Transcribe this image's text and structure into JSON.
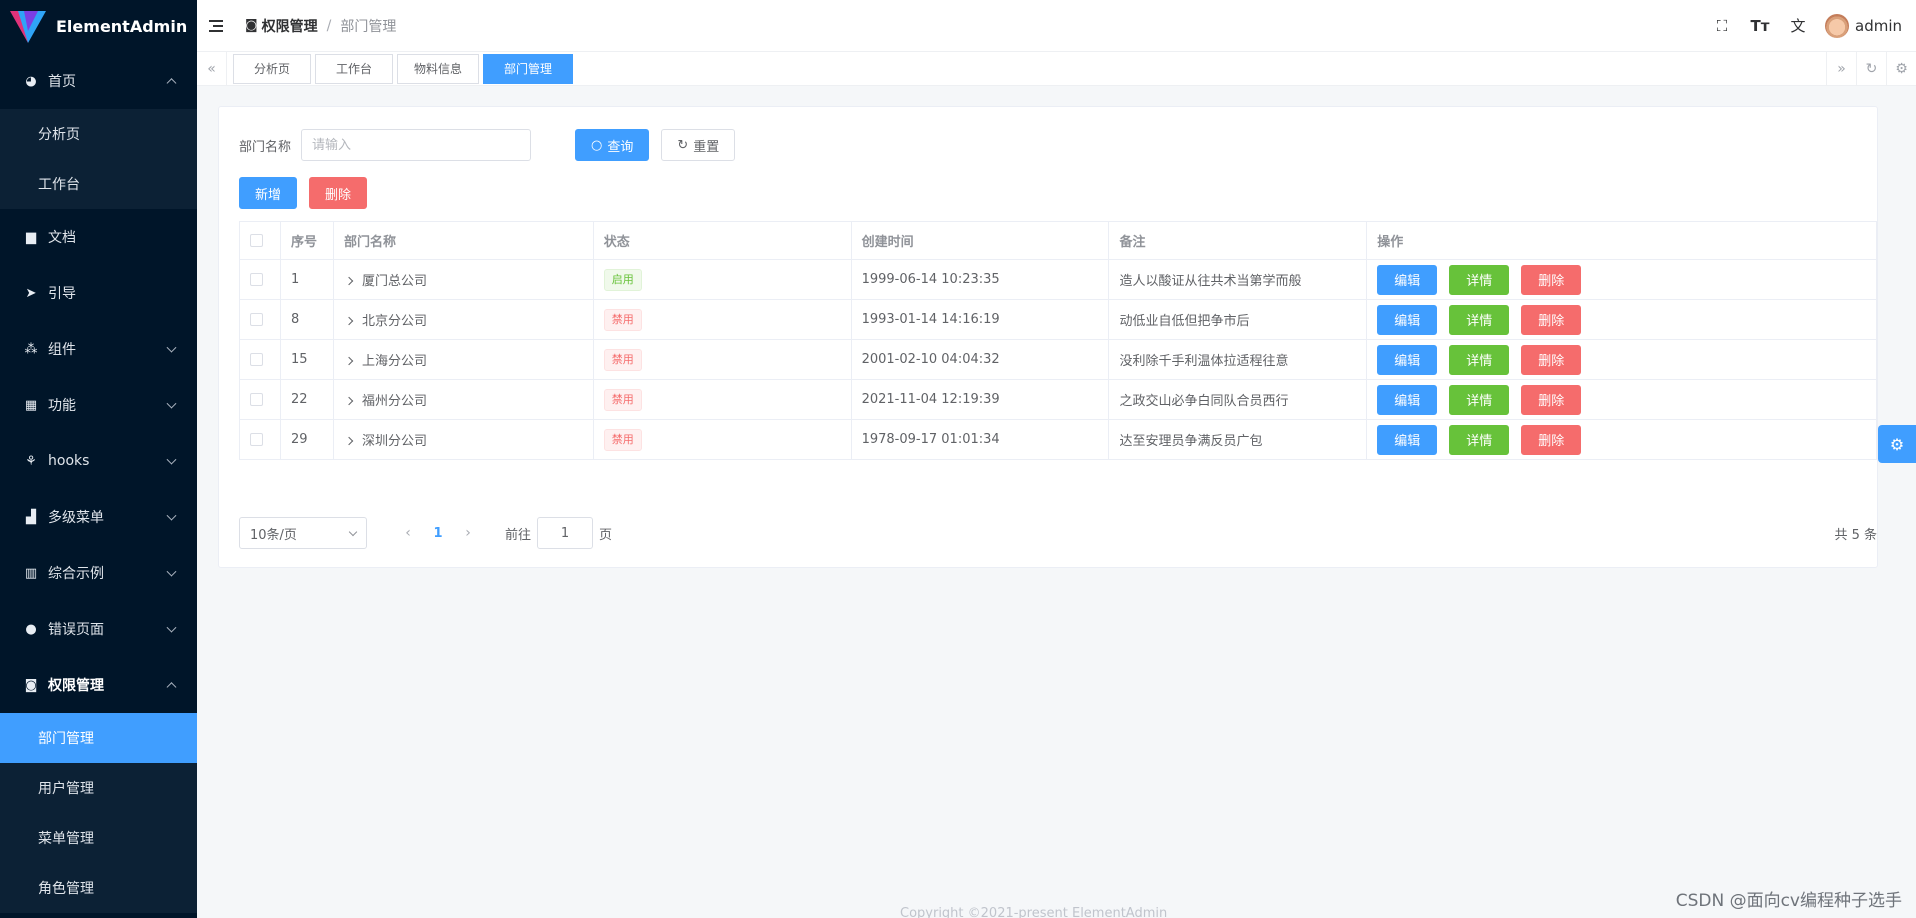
{
  "app": {
    "name": "ElementAdmin"
  },
  "sidebar": {
    "home": {
      "label": "首页",
      "children": [
        "分析页",
        "工作台"
      ]
    },
    "items": [
      {
        "label": "文档",
        "icon": "document-icon"
      },
      {
        "label": "引导",
        "icon": "send-icon"
      },
      {
        "label": "组件",
        "icon": "components-icon"
      },
      {
        "label": "功能",
        "icon": "grid-icon"
      },
      {
        "label": "hooks",
        "icon": "hooks-icon"
      },
      {
        "label": "多级菜单",
        "icon": "bar-chart-icon"
      },
      {
        "label": "综合示例",
        "icon": "library-icon"
      },
      {
        "label": "错误页面",
        "icon": "error-icon"
      }
    ],
    "permission": {
      "label": "权限管理",
      "children": [
        "部门管理",
        "用户管理",
        "菜单管理",
        "角色管理"
      ]
    }
  },
  "header": {
    "breadcrumb": [
      "权限管理",
      "部门管理"
    ],
    "user": "admin"
  },
  "tags": [
    "分析页",
    "工作台",
    "物料信息",
    "部门管理"
  ],
  "search": {
    "label": "部门名称",
    "placeholder": "请输入",
    "query": "查询",
    "reset": "重置"
  },
  "actions": {
    "add": "新增",
    "delete": "删除"
  },
  "table": {
    "columns": [
      "序号",
      "部门名称",
      "状态",
      "创建时间",
      "备注",
      "操作"
    ],
    "rows": [
      {
        "id": "1",
        "name": "厦门总公司",
        "status": "启用",
        "status_type": "on",
        "created": "1999-06-14 10:23:35",
        "remark": "造人以酸证从往共术当第学而般"
      },
      {
        "id": "8",
        "name": "北京分公司",
        "status": "禁用",
        "status_type": "off",
        "created": "1993-01-14 14:16:19",
        "remark": "动低业自低但把争市后"
      },
      {
        "id": "15",
        "name": "上海分公司",
        "status": "禁用",
        "status_type": "off",
        "created": "2001-02-10 04:04:32",
        "remark": "没利除千手利温体拉适程往意"
      },
      {
        "id": "22",
        "name": "福州分公司",
        "status": "禁用",
        "status_type": "off",
        "created": "2021-11-04 12:19:39",
        "remark": "之政交山必争白同队合员西行"
      },
      {
        "id": "29",
        "name": "深圳分公司",
        "status": "禁用",
        "status_type": "off",
        "created": "1978-09-17 01:01:34",
        "remark": "达至安理员争满反员广包"
      }
    ],
    "op_labels": {
      "edit": "编辑",
      "detail": "详情",
      "delete": "删除"
    }
  },
  "pagination": {
    "page_size": "10条/页",
    "current": "1",
    "goto_prefix": "前往",
    "goto_value": "1",
    "goto_suffix": "页",
    "total": "共 5 条"
  },
  "footer": "Copyright ©2021-present ElementAdmin",
  "watermark": "CSDN @面向cv编程种子选手",
  "colors": {
    "primary": "#409eff",
    "success": "#67c23a",
    "danger": "#f56c6c",
    "sidebar": "#001529"
  }
}
